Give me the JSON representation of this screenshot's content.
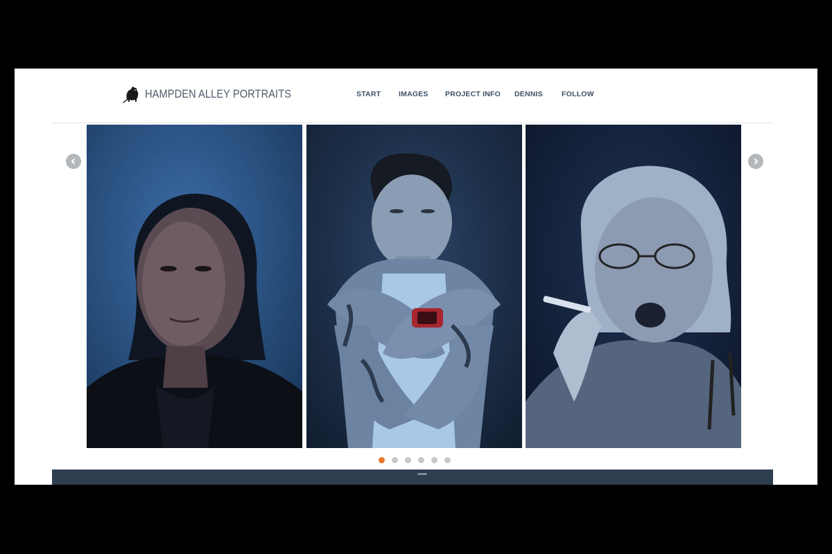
{
  "site": {
    "title": "HAMPDEN ALLEY PORTRAITS",
    "logo_icon": "rat-icon"
  },
  "nav": {
    "items": [
      {
        "label": "START"
      },
      {
        "label": "IMAGES"
      },
      {
        "label": "PROJECT INFO"
      },
      {
        "label": "DENNIS"
      },
      {
        "label": "FOLLOW"
      }
    ]
  },
  "carousel": {
    "prev_icon": "chevron-left-icon",
    "next_icon": "chevron-right-icon",
    "slides": [
      {
        "subject": "portrait of a woman looking left"
      },
      {
        "subject": "portrait of a tattooed man with crossed arms"
      },
      {
        "subject": "portrait of a woman with glasses smoking"
      }
    ],
    "dot_count": 6,
    "active_dot": 1
  },
  "colors": {
    "accent": "#e8772b",
    "nav_text": "#3d5066",
    "footer_bar": "#2e3e50"
  }
}
